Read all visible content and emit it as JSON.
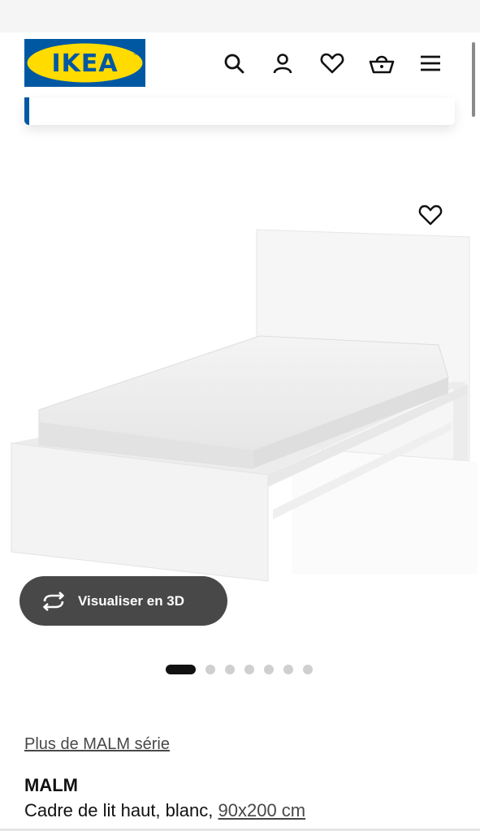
{
  "header": {
    "logo_text": "IKEA",
    "colors": {
      "logo_blue": "#0058a3",
      "logo_yellow": "#ffdb00"
    },
    "icons": [
      "search-icon",
      "account-icon",
      "heart-icon",
      "basket-icon",
      "menu-icon"
    ]
  },
  "product_image": {
    "favourite_icon": "heart-icon"
  },
  "view_3d": {
    "label": "Visualiser en 3D",
    "icon": "rotate-icon"
  },
  "carousel": {
    "total": 7,
    "active": 1
  },
  "product": {
    "series_link": "Plus de MALM série",
    "name": "MALM",
    "description": "Cadre de lit haut, blanc,",
    "size": "90x200 cm"
  }
}
